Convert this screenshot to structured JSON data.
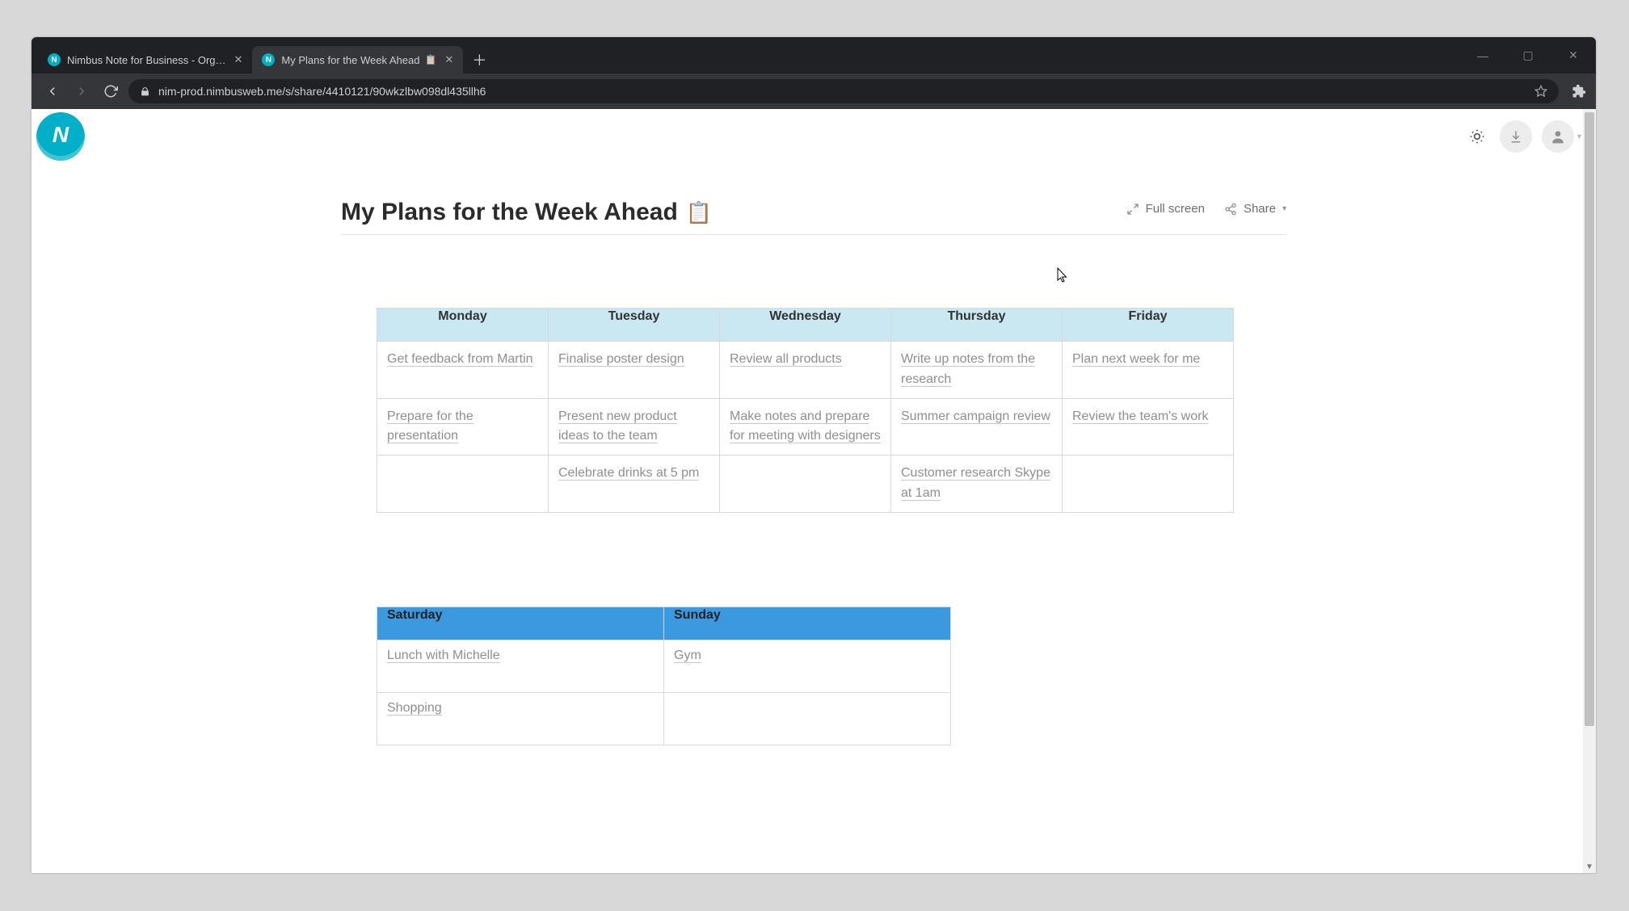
{
  "browser": {
    "tabs": [
      {
        "title": "Nimbus Note for Business - Org…",
        "active": false
      },
      {
        "title": "My Plans for the Week Ahead",
        "active": true,
        "icon_suffix": "📋"
      }
    ],
    "window_controls": {
      "minimize": "—",
      "maximize": "▢",
      "close": "✕"
    },
    "url": "nim-prod.nimbusweb.me/s/share/4410121/90wkzlbw098dl435llh6"
  },
  "appbar": {
    "brand_letter": "N"
  },
  "actions": {
    "fullscreen": "Full screen",
    "share": "Share"
  },
  "doc": {
    "title": "My Plans for the Week Ahead",
    "title_emoji": "📋"
  },
  "weekdays": {
    "columns": [
      "Monday",
      "Tuesday",
      "Wednesday",
      "Thursday",
      "Friday"
    ],
    "rows": [
      [
        "Get feedback from Martin",
        "Finalise poster design",
        "Review all products",
        "Write up notes from the research",
        "Plan next week for me"
      ],
      [
        "Prepare for the presentation",
        "Present new product ideas to the team",
        "Make notes and prepare for meeting with designers",
        "Summer campaign review",
        "Review the team's work"
      ],
      [
        "",
        "Celebrate drinks at 5 pm",
        "",
        "Customer research Skype at 1am",
        ""
      ]
    ]
  },
  "weekend": {
    "columns": [
      "Saturday",
      "Sunday"
    ],
    "rows": [
      [
        "Lunch with Michelle",
        "Gym"
      ],
      [
        "Shopping",
        ""
      ]
    ]
  }
}
